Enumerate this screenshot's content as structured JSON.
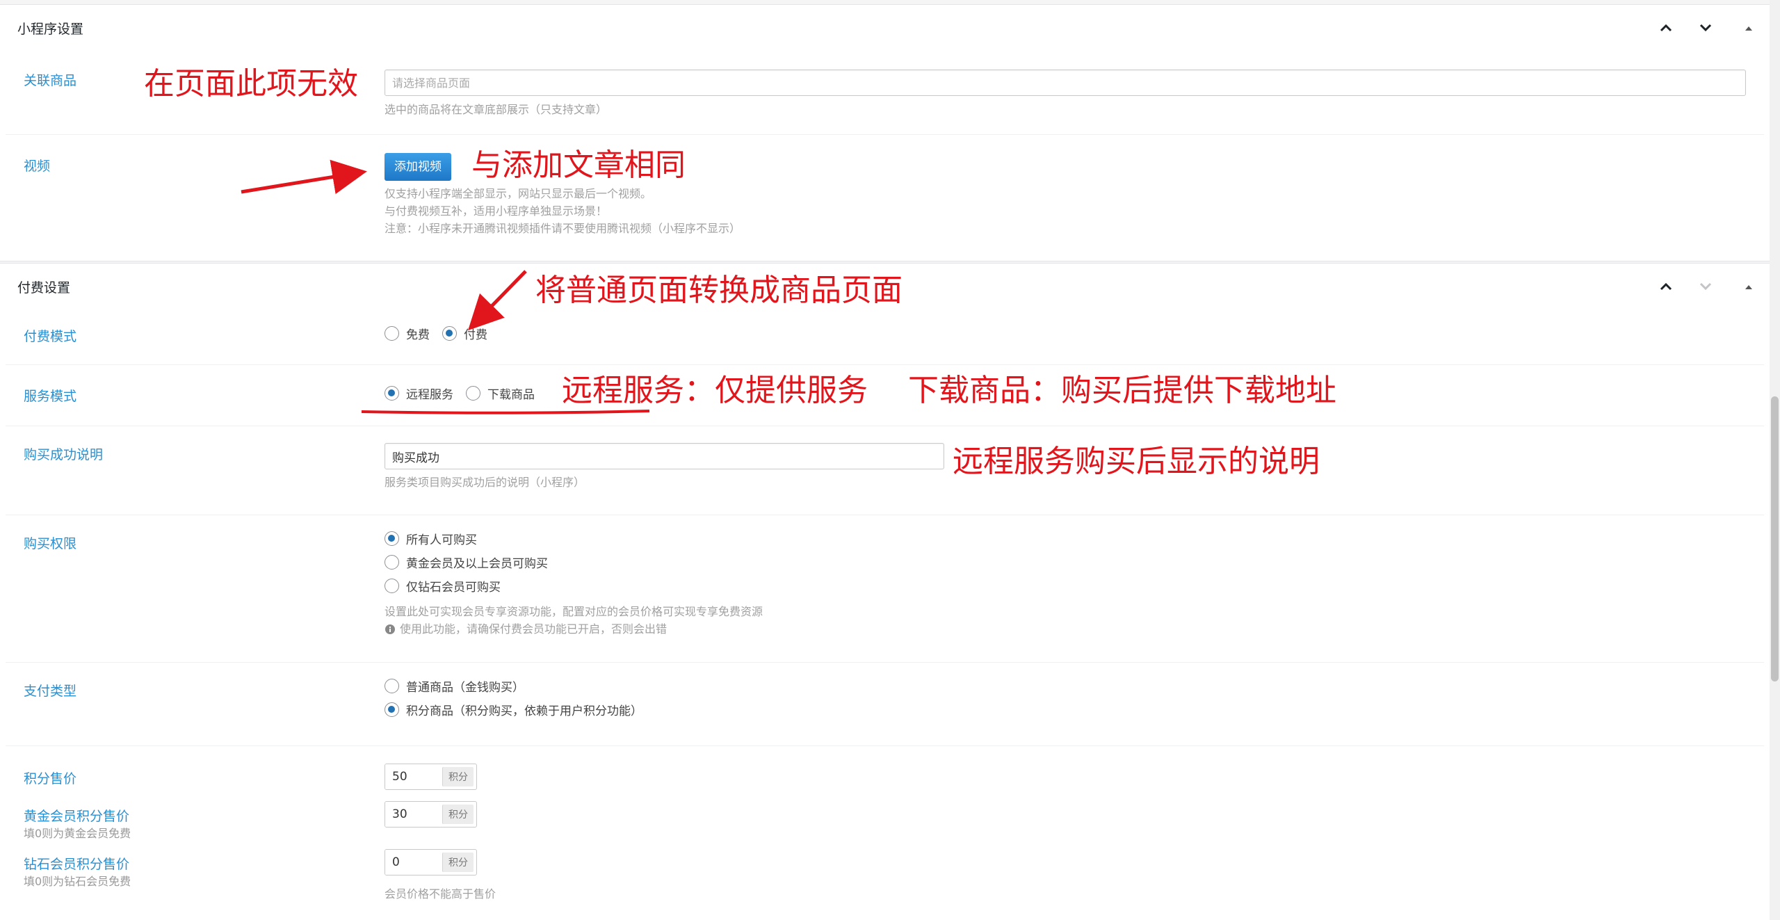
{
  "mini_program_box": {
    "title": "小程序设置",
    "related_product": {
      "label": "关联商品",
      "placeholder": "请选择商品页面",
      "desc": "选中的商品将在文章底部展示（只支持文章）"
    },
    "video": {
      "label": "视频",
      "button": "添加视频",
      "desc_lines": [
        "仅支持小程序端全部显示，网站只显示最后一个视频。",
        "与付费视频互补，适用小程序单独显示场景！",
        "注意：小程序未开通腾讯视频插件请不要使用腾讯视频（小程序不显示）"
      ]
    }
  },
  "paid_box": {
    "title": "付费设置",
    "pay_mode": {
      "label": "付费模式",
      "options": [
        {
          "label": "免费",
          "checked": false
        },
        {
          "label": "付费",
          "checked": true
        }
      ]
    },
    "service_mode": {
      "label": "服务模式",
      "options": [
        {
          "label": "远程服务",
          "checked": true
        },
        {
          "label": "下载商品",
          "checked": false
        }
      ]
    },
    "success_note": {
      "label": "购买成功说明",
      "value": "购买成功",
      "desc": "服务类项目购买成功后的说明（小程序）"
    },
    "purchase_permission": {
      "label": "购买权限",
      "options": [
        {
          "label": "所有人可购买",
          "checked": true
        },
        {
          "label": "黄金会员及以上会员可购买",
          "checked": false
        },
        {
          "label": "仅钻石会员可购买",
          "checked": false
        }
      ],
      "desc": "设置此处可实现会员专享资源功能，配置对应的会员价格可实现专享免费资源",
      "warning": "使用此功能，请确保付费会员功能已开启，否则会出错"
    },
    "payment_type": {
      "label": "支付类型",
      "options": [
        {
          "label": "普通商品（金钱购买）",
          "checked": false
        },
        {
          "label": "积分商品（积分购买，依赖于用户积分功能）",
          "checked": true
        }
      ]
    },
    "points_price": {
      "label": "积分售价",
      "value": "50",
      "unit": "积分"
    },
    "gold_points_price": {
      "label": "黄金会员积分售价",
      "sub": "填0则为黄金会员免费",
      "value": "30",
      "unit": "积分"
    },
    "diamond_points_price": {
      "label": "钻石会员积分售价",
      "sub": "填0则为钻石会员免费",
      "value": "0",
      "unit": "积分"
    },
    "member_price_note": "会员价格不能高于售价"
  },
  "annotations": {
    "related": "在页面此项无效",
    "video": "与添加文章相同",
    "pay_mode": "将普通页面转换成商品页面",
    "service_mode": "远程服务：仅提供服务　 下载商品：购买后提供下载地址",
    "success_note": "远程服务购买后显示的说明"
  },
  "colors": {
    "annotation": "#e0161c",
    "label": "#2a8fd0",
    "radio_on": "#2271b1"
  }
}
